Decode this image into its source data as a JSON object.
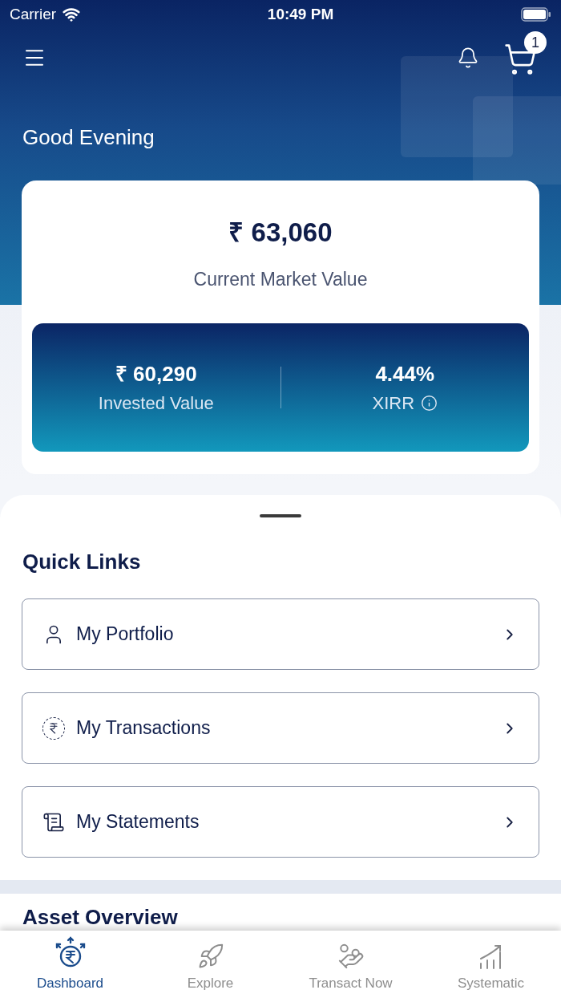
{
  "status_bar": {
    "carrier": "Carrier",
    "time": "10:49 PM"
  },
  "header": {
    "cart_count": "1"
  },
  "greeting": "Good Evening",
  "summary": {
    "market_value": "₹ 63,060",
    "market_value_label": "Current Market Value",
    "invested_value": "₹ 60,290",
    "invested_label": "Invested Value",
    "xirr": "4.44%",
    "xirr_label": "XIRR"
  },
  "quick_links": {
    "title": "Quick Links",
    "items": [
      {
        "label": "My Portfolio"
      },
      {
        "label": "My Transactions"
      },
      {
        "label": "My Statements"
      }
    ]
  },
  "asset_overview": {
    "title": "Asset Overview"
  },
  "tab_bar": [
    {
      "label": "Dashboard",
      "selected": true
    },
    {
      "label": "Explore",
      "selected": false
    },
    {
      "label": "Transact Now",
      "selected": false
    },
    {
      "label": "Systematic",
      "selected": false
    }
  ]
}
